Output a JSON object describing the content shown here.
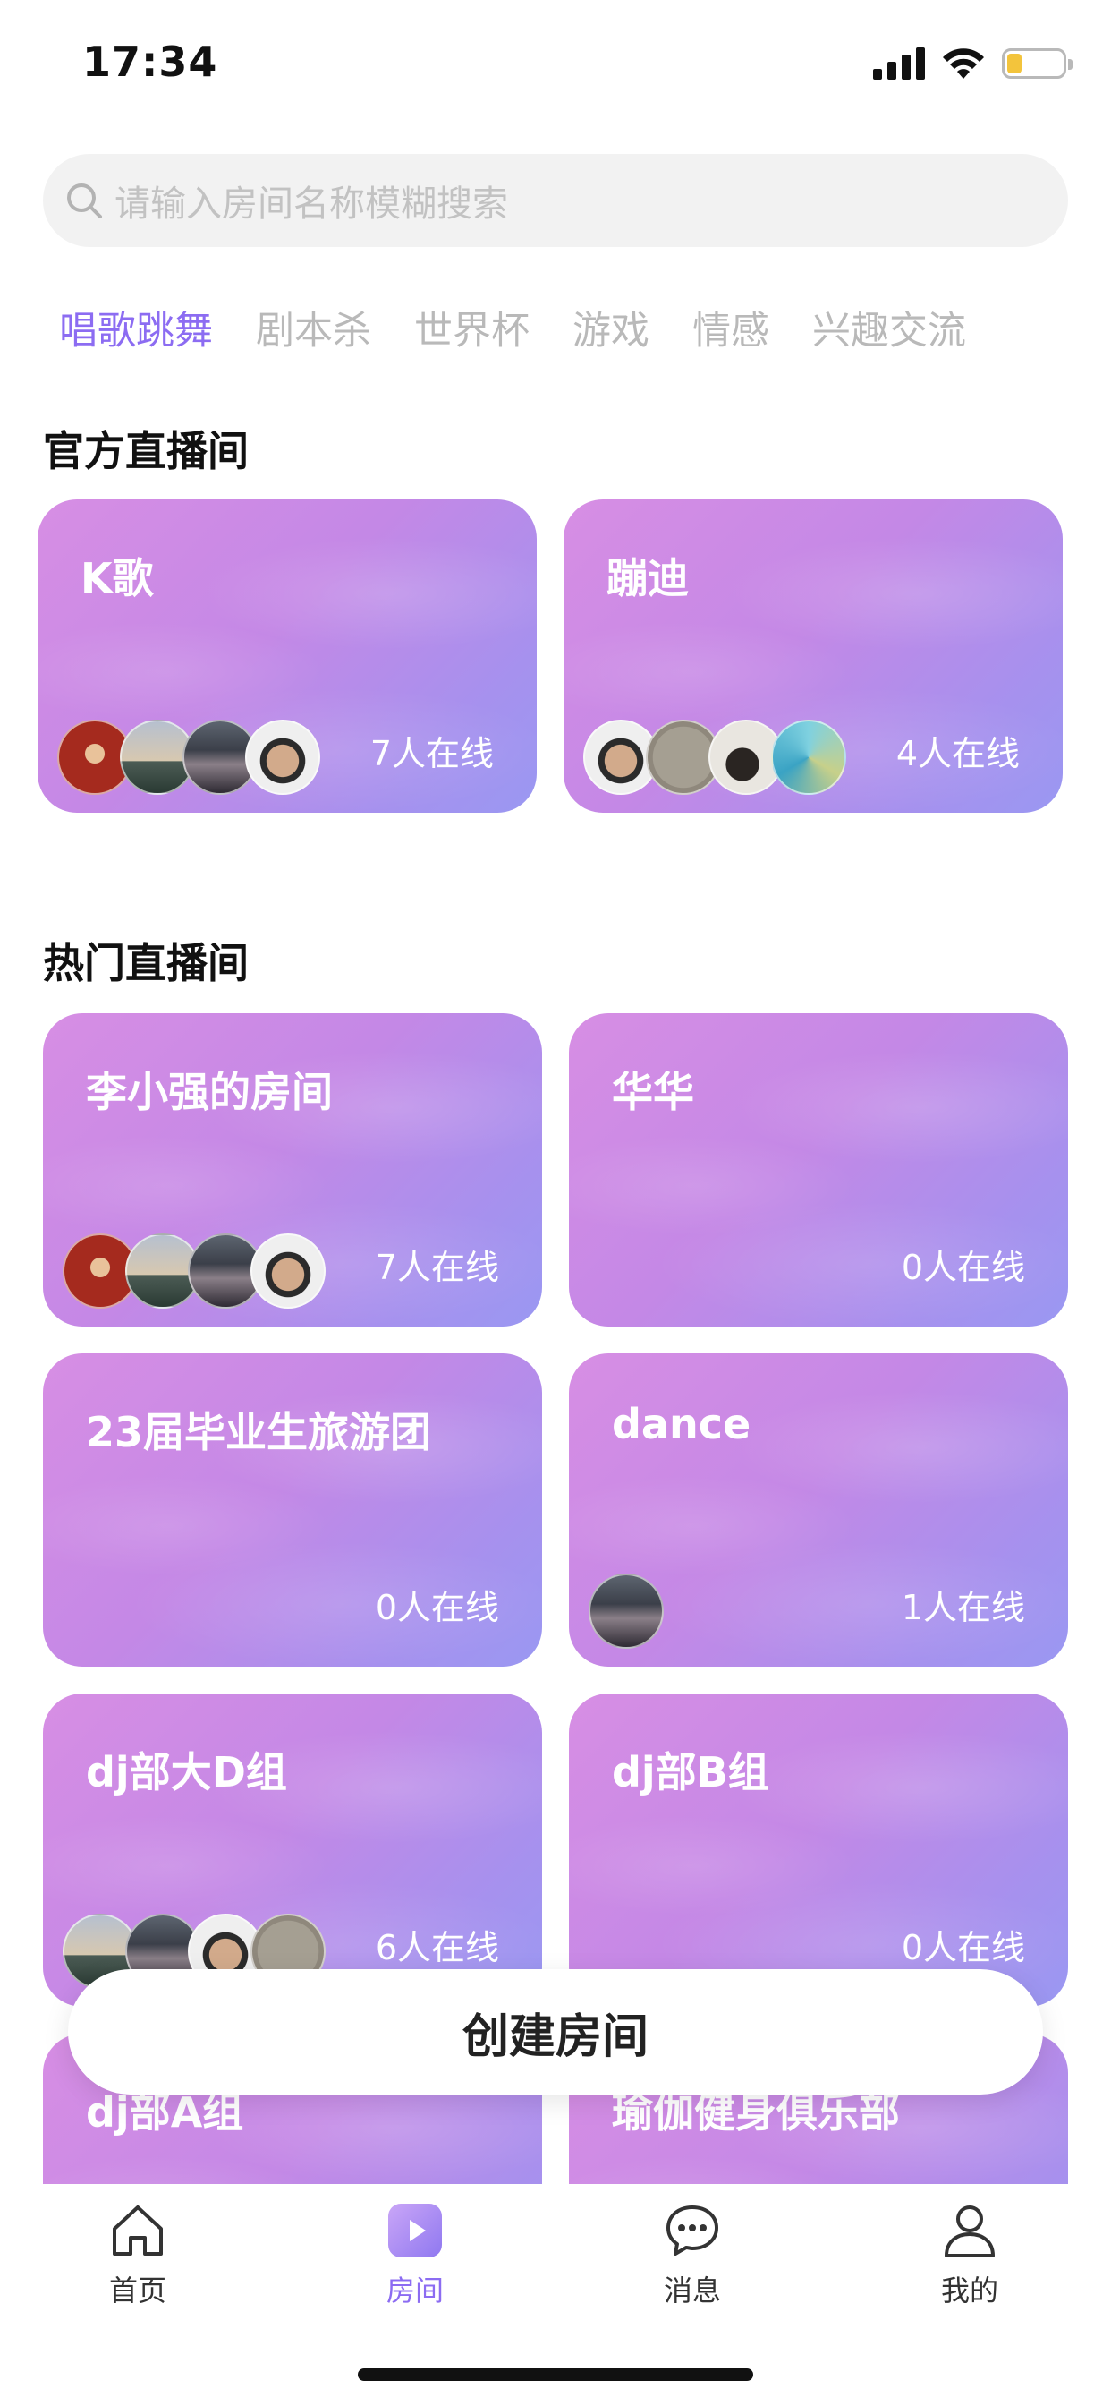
{
  "status_bar": {
    "time": "17:34"
  },
  "search": {
    "placeholder": "请输入房间名称模糊搜索"
  },
  "tabs": [
    {
      "label": "唱歌跳舞",
      "active": true
    },
    {
      "label": "剧本杀",
      "active": false
    },
    {
      "label": "世界杯",
      "active": false
    },
    {
      "label": "游戏",
      "active": false
    },
    {
      "label": "情感",
      "active": false
    },
    {
      "label": "兴趣交流",
      "active": false
    }
  ],
  "official": {
    "title": "官方直播间",
    "rooms": [
      {
        "name": "K歌",
        "online": "7人在线"
      },
      {
        "name": "蹦迪",
        "online": "4人在线"
      }
    ]
  },
  "hot": {
    "title": "热门直播间",
    "rooms": [
      {
        "name": "李小强的房间",
        "online": "7人在线"
      },
      {
        "name": "华华",
        "online": "0人在线"
      },
      {
        "name": "23届毕业生旅游团",
        "online": "0人在线"
      },
      {
        "name": "dance",
        "online": "1人在线"
      },
      {
        "name": "dj部大D组",
        "online": "6人在线"
      },
      {
        "name": "dj部B组",
        "online": "0人在线"
      },
      {
        "name": "dj部A组",
        "online": ""
      },
      {
        "name": "瑜伽健身俱乐部",
        "online": ""
      }
    ]
  },
  "create_button": {
    "label": "创建房间"
  },
  "tabbar": [
    {
      "label": "首页",
      "icon": "home-icon",
      "active": false
    },
    {
      "label": "房间",
      "icon": "play-icon",
      "active": true
    },
    {
      "label": "消息",
      "icon": "message-icon",
      "active": false
    },
    {
      "label": "我的",
      "icon": "profile-icon",
      "active": false
    }
  ],
  "colors": {
    "accent": "#8c6cf2",
    "card_start": "#d78ee4",
    "card_end": "#9a98f2"
  }
}
